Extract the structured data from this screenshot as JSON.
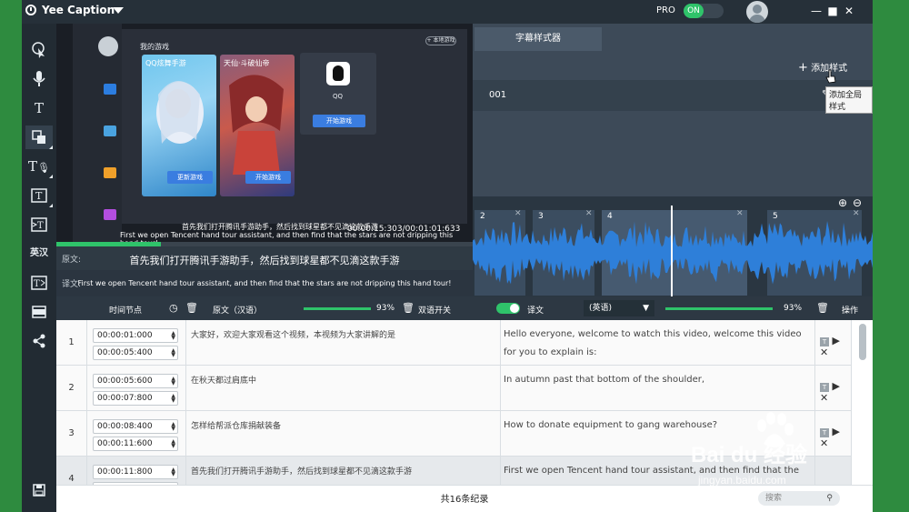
{
  "app": {
    "title": "Yee Caption",
    "pro_label": "PRO",
    "toggle_label": "ON"
  },
  "window": {
    "minimize": "—",
    "maximize": "■",
    "close": "✕"
  },
  "sidebar": {
    "tools": [
      "pointer-tool",
      "microphone-tool",
      "text-tool",
      "shape-tool",
      "voice-text-tool",
      "text-box-tool",
      "insert-text-tool",
      "translate-tool",
      "text-export-tool",
      "video-tool",
      "share-tool",
      "save-tool"
    ],
    "translate_glyph": "英汉"
  },
  "video": {
    "sidebar_label": "我的游戏",
    "panel_button": "+ 本地游戏",
    "card1_title": "QQ炫舞手游",
    "card1_button": "更新游戏",
    "card2_title": "天仙·斗破仙帝",
    "card2_button": "开始游戏",
    "qq_label": "QQ",
    "qq_button": "开始游戏",
    "subtitle_cn": "首先我们打开腾讯手游助手，然后找到球星都不见滴这款手游",
    "subtitle_en": "First we open Tencent hand tour assistant, and then find that the stars are not dripping this hand tour!",
    "timecode": "00:00:15:303/00:01:01:633",
    "progress": 0.25
  },
  "subtitle_rows": {
    "original_label": "原文:",
    "original_text": "首先我们打开腾讯手游助手，然后找到球星都不见滴这款手游",
    "translated_label": "译文:",
    "translated_text": "First we open Tencent hand tour assistant, and then find that the stars are not dripping this hand tour!"
  },
  "style_panel": {
    "tab": "字幕样式器",
    "add_button": "添加样式",
    "style_name": "001",
    "tooltip": "添加全局样式"
  },
  "waveform": {
    "segments": [
      "2",
      "3",
      "4",
      "5"
    ]
  },
  "table_header": {
    "time_col": "时间节点",
    "original_col": "原文（汉语）",
    "original_pct": "93%",
    "bilingual_label": "双语开关",
    "translation_col": "译文",
    "translation_lang": "(英语)",
    "translation_pct": "93%",
    "ops_col": "操作",
    "original_progress": 0.93,
    "translation_progress": 0.93
  },
  "rows": [
    {
      "num": "1",
      "start": "00:00:01:000",
      "end": "00:00:05:400",
      "cn": "大家好，欢迎大家观看这个视频，本视频为大家讲解的是",
      "en": "Hello everyone, welcome to watch this video, welcome this video for you to explain is:"
    },
    {
      "num": "2",
      "start": "00:00:05:600",
      "end": "00:00:07:800",
      "cn": "在秋天都过肩底中",
      "en": "In autumn past that bottom of the shoulder,"
    },
    {
      "num": "3",
      "start": "00:00:08:400",
      "end": "00:00:11:600",
      "cn": "怎样给帮派仓库捐献装备",
      "en": "How to donate equipment to gang warehouse?"
    },
    {
      "num": "4",
      "start": "00:00:11:800",
      "end": "",
      "cn": "首先我们打开腾讯手游助手，然后找到球星都不见滴这款手游",
      "en": "First we open Tencent hand tour assistant, and then find that the"
    }
  ],
  "footer": {
    "count": "共16条纪录",
    "search_placeholder": "搜索"
  },
  "watermark": {
    "text": "Bai du 经验",
    "url": "jingyan.baidu.com"
  }
}
